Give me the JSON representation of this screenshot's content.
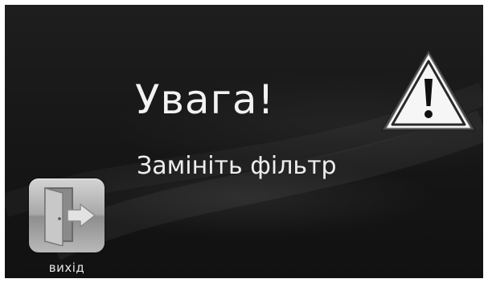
{
  "alert": {
    "title": "Увага!",
    "message": "Замініть фільтр"
  },
  "exit_button": {
    "label": "вихід",
    "icon": "door-exit-icon"
  },
  "warning": {
    "icon": "warning-triangle-icon"
  },
  "colors": {
    "background": "#161616",
    "text": "#f2f2f2",
    "button_tile": "#a9a9a9"
  }
}
